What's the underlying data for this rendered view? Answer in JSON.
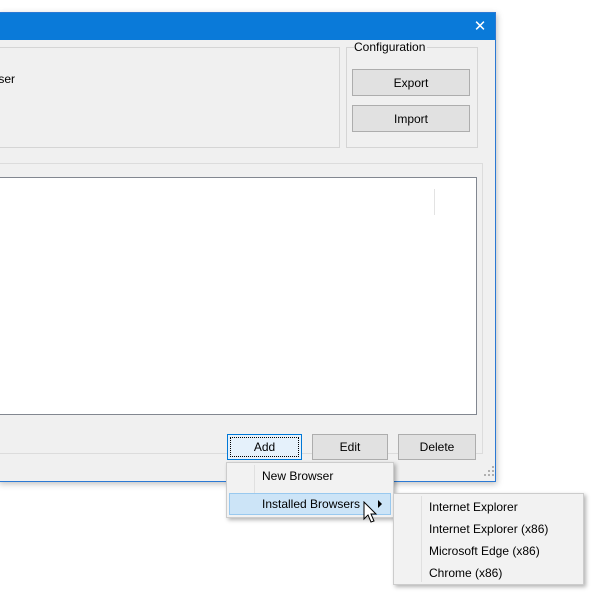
{
  "window": {
    "close_glyph": "✕",
    "partial_label": "ser"
  },
  "configuration": {
    "legend": "Configuration",
    "export_label": "Export",
    "import_label": "Import"
  },
  "actions": {
    "add_label": "Add",
    "edit_label": "Edit",
    "delete_label": "Delete"
  },
  "context_menu": {
    "items": [
      {
        "label": "New Browser"
      },
      {
        "label": "Installed Browsers",
        "highlighted": true,
        "has_submenu": true
      }
    ]
  },
  "submenu": {
    "items": [
      {
        "label": "Internet Explorer"
      },
      {
        "label": "Internet Explorer (x86)"
      },
      {
        "label": "Microsoft Edge (x86)"
      },
      {
        "label": "Chrome (x86)"
      }
    ]
  },
  "colors": {
    "titlebar": "#0a7ad9",
    "highlight": "#cce4f7",
    "focus_border": "#0078d7"
  }
}
